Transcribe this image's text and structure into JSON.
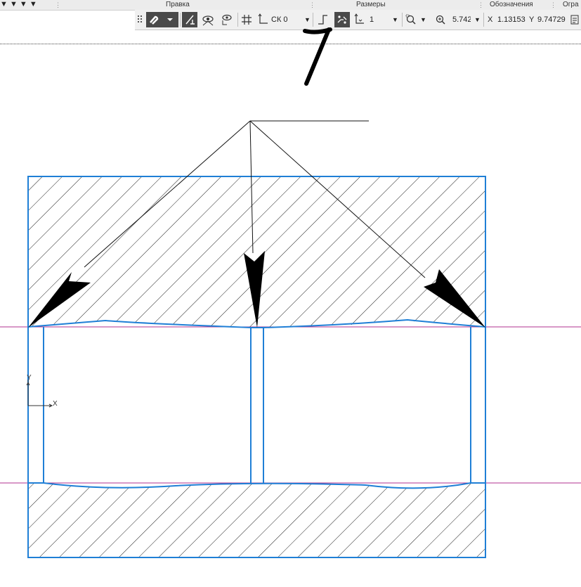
{
  "panels": {
    "edit_label": "Правка",
    "dimensions_label": "Размеры",
    "designations_label": "Обозначения",
    "limits_label": "Огра"
  },
  "toolbar": {
    "cs_label": "СК 0",
    "step_value": "1",
    "zoom_value": "5.742",
    "x_label": "X",
    "x_value": "1.13153",
    "y_label": "Y",
    "y_value": "9.74729"
  },
  "axis_indicator": {
    "x_label": "X",
    "y_label": "Y"
  },
  "colors": {
    "part_outline": "#1f7fd6",
    "hatch": "#222222",
    "guide_line": "#b0308f",
    "toolbar_dark": "#4a4a4a"
  }
}
